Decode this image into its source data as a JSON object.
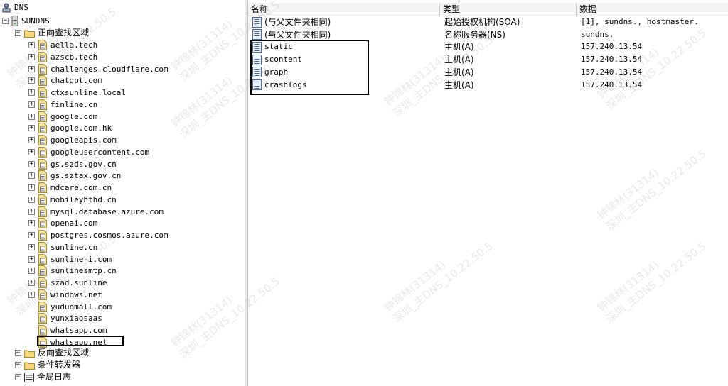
{
  "tree": {
    "root_label": "DNS",
    "server_label": "SUNDNS",
    "forward_zones_label": "正向查找区域",
    "zones": [
      {
        "label": "aella.tech",
        "expandable": true
      },
      {
        "label": "azscb.tech",
        "expandable": true
      },
      {
        "label": "challenges.cloudflare.com",
        "expandable": true
      },
      {
        "label": "chatgpt.com",
        "expandable": true
      },
      {
        "label": "ctxsunline.local",
        "expandable": true
      },
      {
        "label": "finline.cn",
        "expandable": true
      },
      {
        "label": "google.com",
        "expandable": true
      },
      {
        "label": "google.com.hk",
        "expandable": true
      },
      {
        "label": "googleapis.com",
        "expandable": true
      },
      {
        "label": "googleusercontent.com",
        "expandable": true
      },
      {
        "label": "gs.szds.gov.cn",
        "expandable": true
      },
      {
        "label": "gs.sztax.gov.cn",
        "expandable": true
      },
      {
        "label": "mdcare.com.cn",
        "expandable": true
      },
      {
        "label": "mobileyhthd.cn",
        "expandable": true
      },
      {
        "label": "mysql.database.azure.com",
        "expandable": true
      },
      {
        "label": "openai.com",
        "expandable": true
      },
      {
        "label": "postgres.cosmos.azure.com",
        "expandable": true
      },
      {
        "label": "sunline.cn",
        "expandable": true
      },
      {
        "label": "sunline-i.com",
        "expandable": true
      },
      {
        "label": "sunlinesmtp.cn",
        "expandable": true
      },
      {
        "label": "szad.sunline",
        "expandable": true
      },
      {
        "label": "windows.net",
        "expandable": true
      },
      {
        "label": "yuduomall.com",
        "expandable": false
      },
      {
        "label": "yunxiaosaas",
        "expandable": false
      },
      {
        "label": "whatsapp.com",
        "expandable": false
      },
      {
        "label": "whatsapp.net",
        "expandable": false
      }
    ],
    "reverse_zones_label": "反向查找区域",
    "conditional_forwarders_label": "条件转发器",
    "global_logs_label": "全局日志"
  },
  "list": {
    "headers": {
      "name": "名称",
      "type": "类型",
      "data": "数据"
    },
    "rows": [
      {
        "name": "(与父文件夹相同)",
        "type": "起始授权机构(SOA)",
        "data": "[1], sundns., hostmaster."
      },
      {
        "name": "(与父文件夹相同)",
        "type": "名称服务器(NS)",
        "data": "sundns."
      },
      {
        "name": "static",
        "type": "主机(A)",
        "data": "157.240.13.54"
      },
      {
        "name": "scontent",
        "type": "主机(A)",
        "data": "157.240.13.54"
      },
      {
        "name": "graph",
        "type": "主机(A)",
        "data": "157.240.13.54"
      },
      {
        "name": "crashlogs",
        "type": "主机(A)",
        "data": "157.240.13.54"
      }
    ]
  },
  "watermark": {
    "line1": "钟锦林(31314)",
    "line2": "深圳_主DNS_10.22.50.5"
  }
}
